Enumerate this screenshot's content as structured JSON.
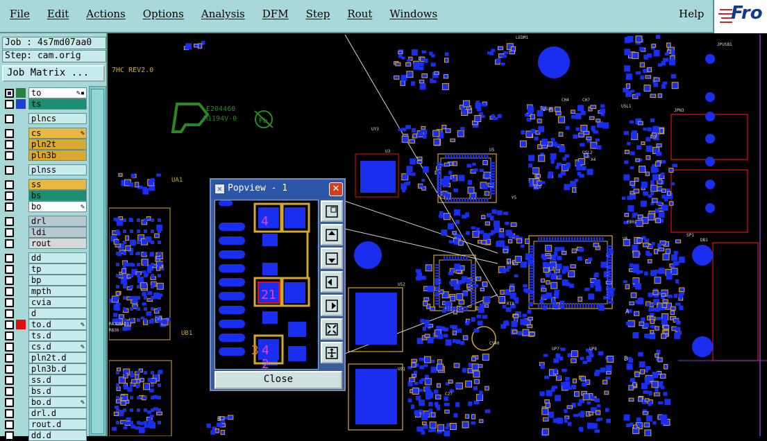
{
  "menu": {
    "items": [
      "File",
      "Edit",
      "Actions",
      "Options",
      "Analysis",
      "DFM",
      "Step",
      "Rout",
      "Windows"
    ],
    "help": "Help",
    "logo": "Fro"
  },
  "job": {
    "label": "Job : 4s7md07aa0",
    "step": "Step: cam.orig",
    "matrix_button": "Job Matrix ..."
  },
  "layers": [
    {
      "name": "to",
      "color": "#2a8040",
      "name_bg": "#ffffff",
      "checked": true,
      "mark": "✎▪"
    },
    {
      "name": "ts",
      "color": "#2040d0",
      "name_bg": "#1a9070",
      "checked": false,
      "mark": ""
    },
    {
      "name": "plncs",
      "color": "",
      "name_bg": "#c8eaea",
      "checked": false,
      "mark": "",
      "gap": true
    },
    {
      "name": "cs",
      "color": "",
      "name_bg": "#e8b840",
      "checked": false,
      "mark": "✎",
      "gap": true
    },
    {
      "name": "pln2t",
      "color": "",
      "name_bg": "#d8a830",
      "checked": false,
      "mark": ""
    },
    {
      "name": "pln3b",
      "color": "",
      "name_bg": "#d8a830",
      "checked": false,
      "mark": ""
    },
    {
      "name": "plnss",
      "color": "",
      "name_bg": "#c8eaea",
      "checked": false,
      "mark": "",
      "gap": true
    },
    {
      "name": "ss",
      "color": "",
      "name_bg": "#e8b840",
      "checked": false,
      "mark": "",
      "gap": true
    },
    {
      "name": "bs",
      "color": "",
      "name_bg": "#1a9070",
      "checked": false,
      "mark": ""
    },
    {
      "name": "bo",
      "color": "",
      "name_bg": "#ffffff",
      "checked": false,
      "mark": "✎"
    },
    {
      "name": "drl",
      "color": "",
      "name_bg": "#b8c8d0",
      "checked": false,
      "mark": "",
      "gap": true
    },
    {
      "name": "ldi",
      "color": "",
      "name_bg": "#b8c8d0",
      "checked": false,
      "mark": ""
    },
    {
      "name": "rout",
      "color": "",
      "name_bg": "#d8d8d8",
      "checked": false,
      "mark": ""
    },
    {
      "name": "dd",
      "color": "",
      "name_bg": "#c8eaea",
      "checked": false,
      "mark": "",
      "gap": true
    },
    {
      "name": "tp",
      "color": "",
      "name_bg": "#c8eaea",
      "checked": false,
      "mark": ""
    },
    {
      "name": "bp",
      "color": "",
      "name_bg": "#c8eaea",
      "checked": false,
      "mark": ""
    },
    {
      "name": "mpth",
      "color": "",
      "name_bg": "#c8eaea",
      "checked": false,
      "mark": ""
    },
    {
      "name": "cvia",
      "color": "",
      "name_bg": "#c8eaea",
      "checked": false,
      "mark": ""
    },
    {
      "name": "d",
      "color": "",
      "name_bg": "#c8eaea",
      "checked": false,
      "mark": ""
    },
    {
      "name": "to.d",
      "color": "#e01010",
      "name_bg": "#c8eaea",
      "checked": false,
      "mark": "✎"
    },
    {
      "name": "ts.d",
      "color": "",
      "name_bg": "#c8eaea",
      "checked": false,
      "mark": ""
    },
    {
      "name": "cs.d",
      "color": "",
      "name_bg": "#c8eaea",
      "checked": false,
      "mark": "✎"
    },
    {
      "name": "pln2t.d",
      "color": "",
      "name_bg": "#c8eaea",
      "checked": false,
      "mark": ""
    },
    {
      "name": "pln3b.d",
      "color": "",
      "name_bg": "#c8eaea",
      "checked": false,
      "mark": ""
    },
    {
      "name": "ss.d",
      "color": "",
      "name_bg": "#c8eaea",
      "checked": false,
      "mark": ""
    },
    {
      "name": "bs.d",
      "color": "",
      "name_bg": "#c8eaea",
      "checked": false,
      "mark": ""
    },
    {
      "name": "bo.d",
      "color": "",
      "name_bg": "#c8eaea",
      "checked": false,
      "mark": "✎"
    },
    {
      "name": "drl.d",
      "color": "",
      "name_bg": "#c8eaea",
      "checked": false,
      "mark": ""
    },
    {
      "name": "rout.d",
      "color": "",
      "name_bg": "#c8eaea",
      "checked": false,
      "mark": ""
    },
    {
      "name": "dd.d",
      "color": "",
      "name_bg": "#c8eaea",
      "checked": false,
      "mark": ""
    }
  ],
  "board": {
    "colors": {
      "pad": "#1a2ef0",
      "silk": "#d4a830",
      "logo": "#2a8a20",
      "outline": "#e01010",
      "text": "#d8d8d8"
    },
    "labels": {
      "rev": "7HC REV2.0",
      "ua1": "UA1",
      "ub1": "UB1",
      "cert": "E204460",
      "cert2": "M1194V-0",
      "pb": "Pb",
      "ledm": "LEDM1",
      "u3": "U3",
      "u5": "U5",
      "u9": "U9",
      "ul0": "UL0",
      "uy3": "UY3",
      "u6": "U6",
      "jpn3": "JPN3",
      "jpusb1": "JPUSB1",
      "db1": "DB1",
      "sp1": "SP1",
      "up7": "UP7",
      "up8": "UP8",
      "b1": "B",
      "b2": "B",
      "a": "A",
      "fb01": "FB01",
      "cv3": "CV3",
      "ra22": "RA22RA21",
      "rb36": "RB36",
      "rt8": "RT8",
      "rt9": "RT9",
      "c540": "C540",
      "c27": "C27",
      "u52": "U52",
      "u91": "U91",
      "x4": "X4",
      "y5": "Y5",
      "ch4": "CH4",
      "ch7": "CH7",
      "usl6": "USL6",
      "usl1": "USL1",
      "usl2": "USL2"
    }
  },
  "popview": {
    "title": "Popview - 1",
    "close_label": "Close",
    "pad_numbers": [
      "4",
      "21",
      "3",
      "4",
      "2"
    ],
    "buttons": [
      "zoom-window",
      "pan-up",
      "pan-down",
      "pan-left",
      "pan-right",
      "zoom-in",
      "zoom-out"
    ]
  }
}
